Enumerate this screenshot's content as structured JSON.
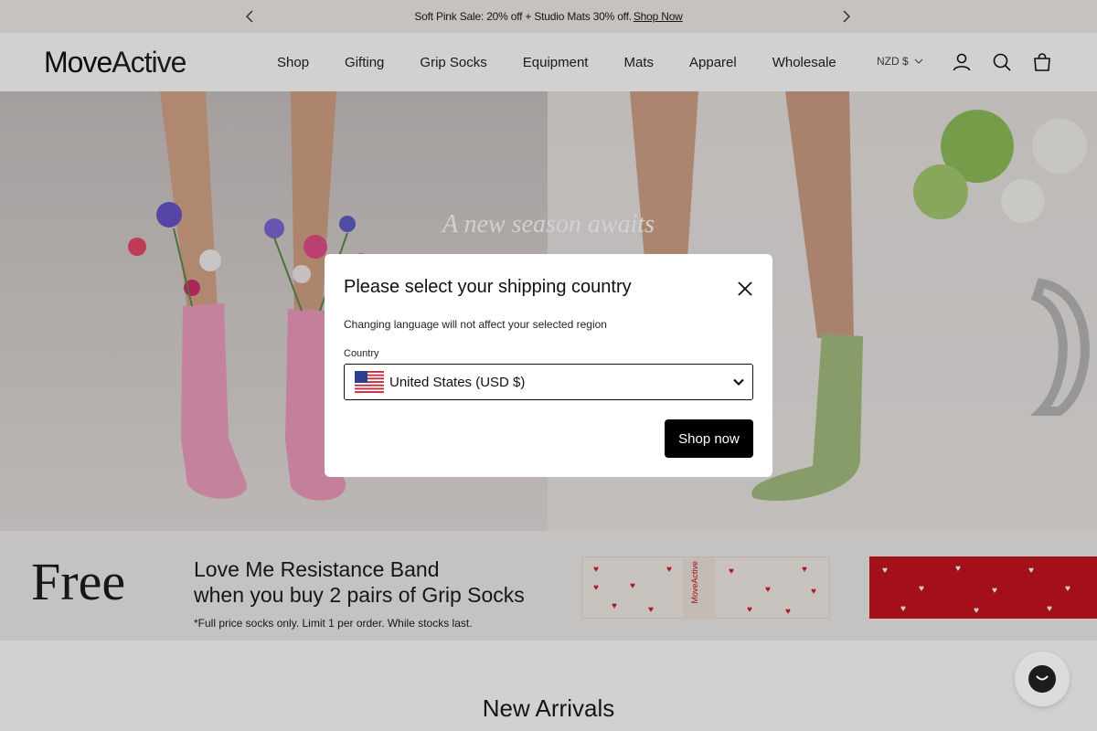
{
  "announcement": {
    "text": "Soft Pink Sale: 20% off + Studio Mats 30% off.",
    "link": "Shop Now"
  },
  "header": {
    "logo_bold": "Move",
    "logo_light": "Active",
    "nav": [
      "Shop",
      "Gifting",
      "Grip Socks",
      "Equipment",
      "Mats",
      "Apparel",
      "Wholesale"
    ],
    "currency": "NZD $"
  },
  "hero": {
    "title": "A new season awaits"
  },
  "promo": {
    "headline": "Free",
    "line1": "Love Me Resistance Band",
    "line2": "when you buy 2 pairs of Grip Socks",
    "fine_print": "*Full price socks only. Limit 1 per order. While stocks last.",
    "band_label": "MoveActive"
  },
  "sections": {
    "new_arrivals": "New Arrivals"
  },
  "modal": {
    "title": "Please select your shipping country",
    "subtitle": "Changing language will not affect your selected region",
    "field_label": "Country",
    "selected_country": "United States (USD $)",
    "button": "Shop now"
  },
  "colors": {
    "announcement_bg": "#f3ece9",
    "button_bg": "#000000",
    "band_red": "#c8141f"
  }
}
